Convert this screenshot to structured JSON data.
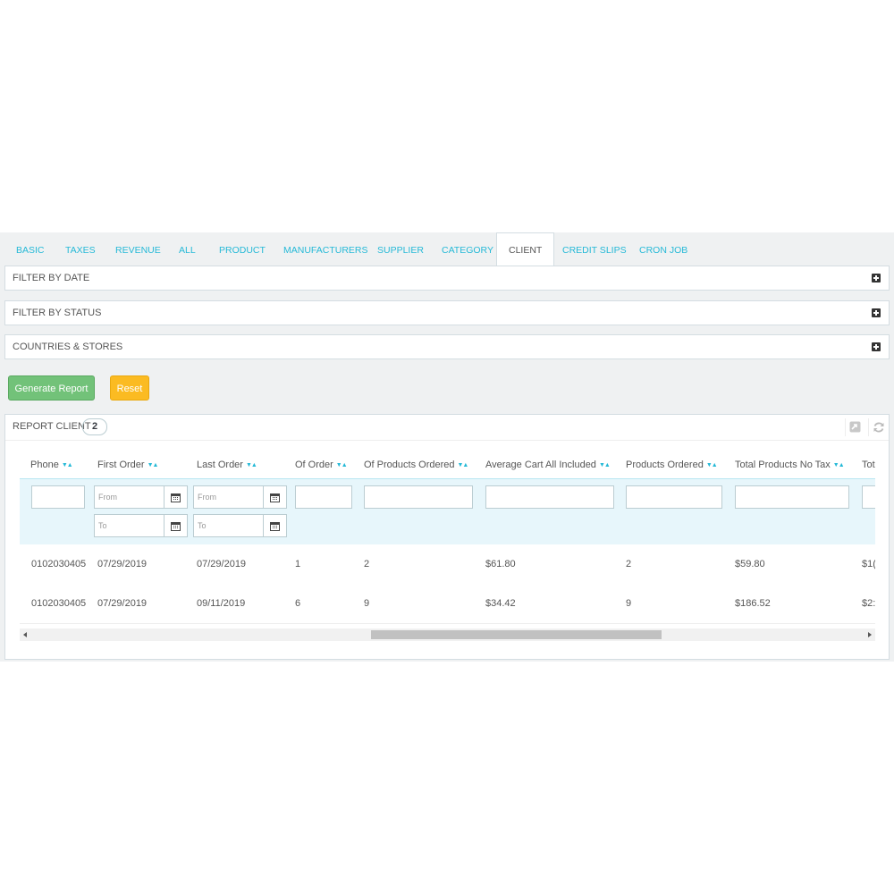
{
  "tabs": [
    {
      "label": "BASIC"
    },
    {
      "label": "TAXES"
    },
    {
      "label": "REVENUE"
    },
    {
      "label": "ALL"
    },
    {
      "label": "PRODUCT"
    },
    {
      "label": "MANUFACTURERS"
    },
    {
      "label": "SUPPLIER"
    },
    {
      "label": "CATEGORY"
    },
    {
      "label": "CLIENT",
      "active": true
    },
    {
      "label": "CREDIT SLIPS"
    },
    {
      "label": "CRON JOB"
    }
  ],
  "panels": {
    "filter_date": "FILTER BY DATE",
    "filter_status": "FILTER BY STATUS",
    "countries": "COUNTRIES & STORES"
  },
  "buttons": {
    "generate": "Generate Report",
    "reset": "Reset"
  },
  "report": {
    "title": "REPORT CLIENT",
    "count": "2",
    "columns": [
      "Phone",
      "First Order",
      "Last Order",
      "Of Order",
      "Of Products Ordered",
      "Average Cart All Included",
      "Products Ordered",
      "Total Products No Tax",
      "Tot"
    ],
    "sort_glyph": "▼▲",
    "filters": {
      "from_placeholder": "From",
      "to_placeholder": "To"
    },
    "rows": [
      {
        "phone": "0102030405",
        "first": "07/29/2019",
        "last": "07/29/2019",
        "of_order": "1",
        "of_products": "2",
        "avg_cart": "$61.80",
        "products_ordered": "2",
        "total_no_tax": "$59.80",
        "total": "$1("
      },
      {
        "phone": "0102030405",
        "first": "07/29/2019",
        "last": "09/11/2019",
        "of_order": "6",
        "of_products": "9",
        "avg_cart": "$34.42",
        "products_ordered": "9",
        "total_no_tax": "$186.52",
        "total": "$2:"
      }
    ]
  },
  "colors": {
    "accent": "#25b9d7",
    "success": "#72c279",
    "warning": "#fbbb22",
    "filter_row_bg": "#e7f6fb"
  }
}
